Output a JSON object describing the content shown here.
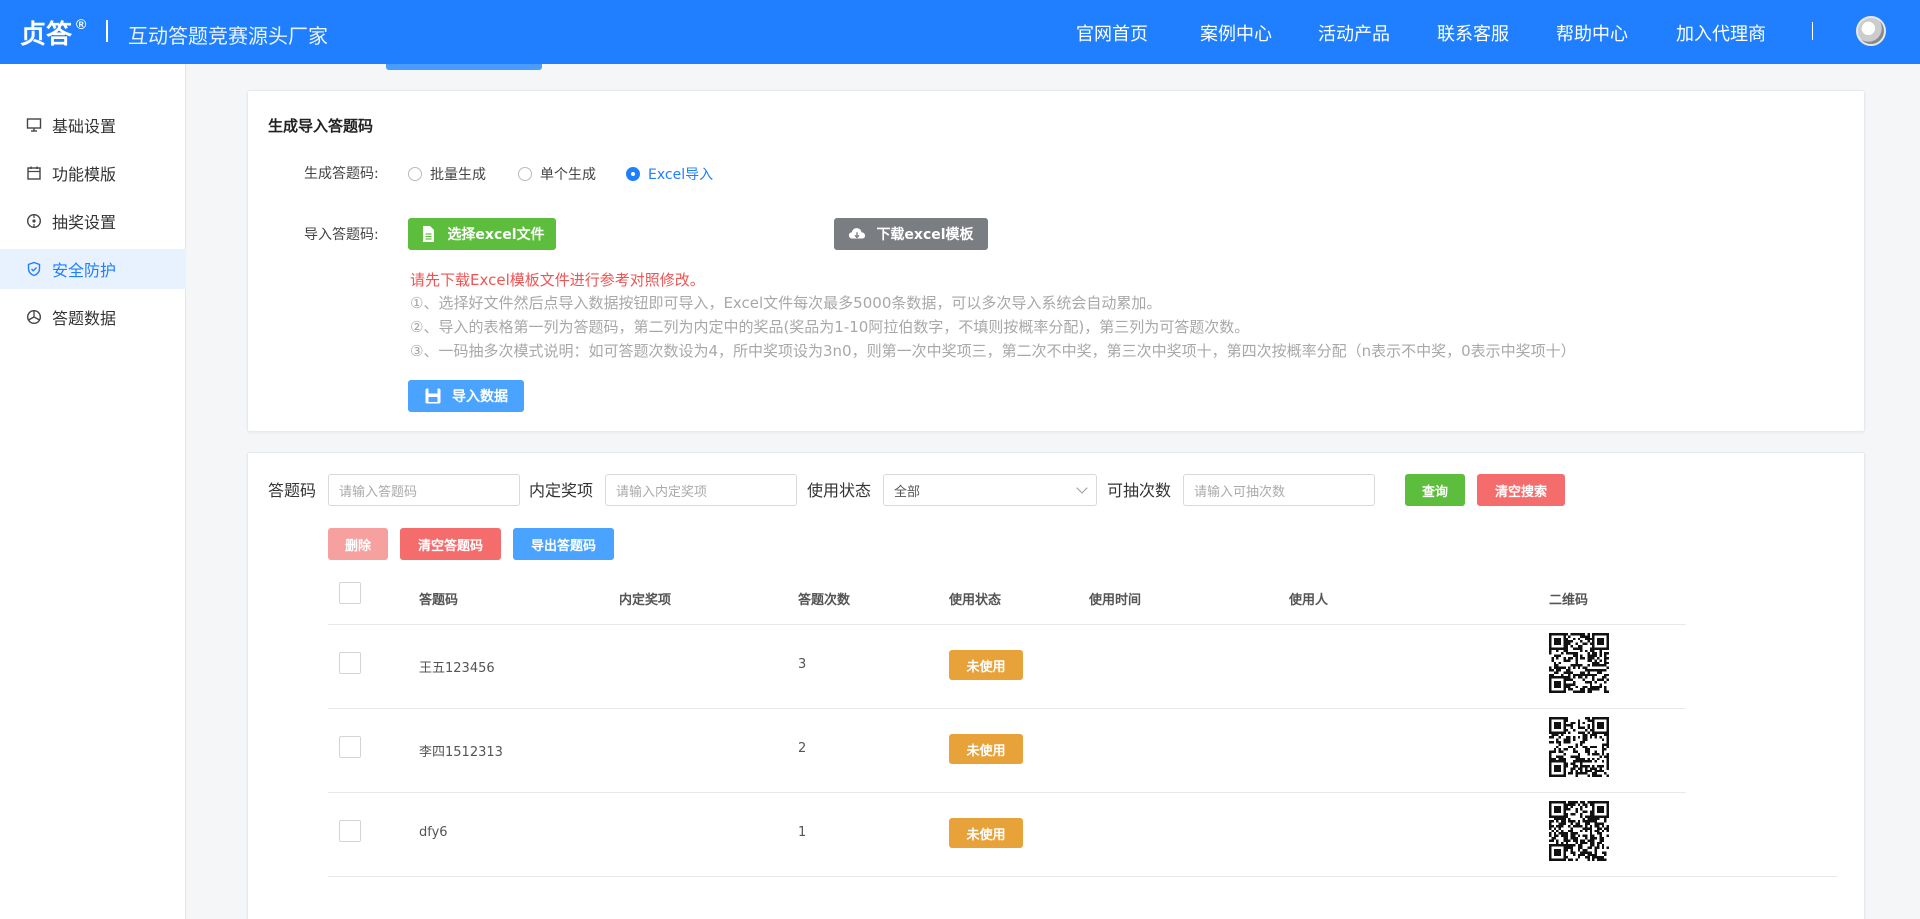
{
  "header": {
    "logo": "贞答",
    "logo_mark": "®",
    "slogan": "互动答题竞赛源头厂家",
    "nav": [
      "官网首页",
      "案例中心",
      "活动产品",
      "联系客服",
      "帮助中心",
      "加入代理商"
    ]
  },
  "sidebar": {
    "items": [
      {
        "label": "基础设置",
        "icon": "monitor-icon"
      },
      {
        "label": "功能模版",
        "icon": "calendar-icon"
      },
      {
        "label": "抽奖设置",
        "icon": "gift-icon"
      },
      {
        "label": "安全防护",
        "icon": "shield-icon",
        "active": true
      },
      {
        "label": "答题数据",
        "icon": "chart-icon"
      }
    ]
  },
  "import_card": {
    "title": "生成导入答题码",
    "generate_label": "生成答题码:",
    "radios": [
      {
        "label": "批量生成",
        "checked": false
      },
      {
        "label": "单个生成",
        "checked": false
      },
      {
        "label": "Excel导入",
        "checked": true
      }
    ],
    "import_label": "导入答题码:",
    "select_file_button": "选择excel文件",
    "download_template_button": "下载excel模板",
    "tip_red": "请先下载Excel模板文件进行参考对照修改。",
    "tips": [
      "①、选择好文件然后点导入数据按钮即可导入，Excel文件每次最多5000条数据，可以多次导入系统会自动累加。",
      "②、导入的表格第一列为答题码，第二列为内定中的奖品(奖品为1-10阿拉伯数字，不填则按概率分配)，第三列为可答题次数。",
      "③、一码抽多次模式说明：如可答题次数设为4，所中奖项设为3n0，则第一次中奖项三，第二次不中奖，第三次中奖项十，第四次按概率分配（n表示不中奖，0表示中奖项十）"
    ],
    "import_button": "导入数据"
  },
  "list_card": {
    "search": {
      "code_label": "答题码",
      "code_placeholder": "请输入答题码",
      "prize_label": "内定奖项",
      "prize_placeholder": "请输入内定奖项",
      "status_label": "使用状态",
      "status_value": "全部",
      "draws_label": "可抽次数",
      "draws_placeholder": "请输入可抽次数",
      "query_button": "查询",
      "clear_search_button": "清空搜索"
    },
    "actions": {
      "delete_button": "删除",
      "clear_codes_button": "清空答题码",
      "export_button": "导出答题码"
    },
    "columns": [
      "答题码",
      "内定奖项",
      "答题次数",
      "使用状态",
      "使用时间",
      "使用人",
      "二维码"
    ],
    "rows": [
      {
        "code": "王五123456",
        "prize": "",
        "count": "3",
        "status": "未使用",
        "time": "",
        "user": ""
      },
      {
        "code": "李四1512313",
        "prize": "",
        "count": "2",
        "status": "未使用",
        "time": "",
        "user": ""
      },
      {
        "code": "dfy6",
        "prize": "",
        "count": "1",
        "status": "未使用",
        "time": "",
        "user": ""
      }
    ]
  },
  "colors": {
    "brand": "#1f7fff",
    "green": "#5dbd3c",
    "red": "#f56c6c",
    "orange": "#e8a23a"
  }
}
